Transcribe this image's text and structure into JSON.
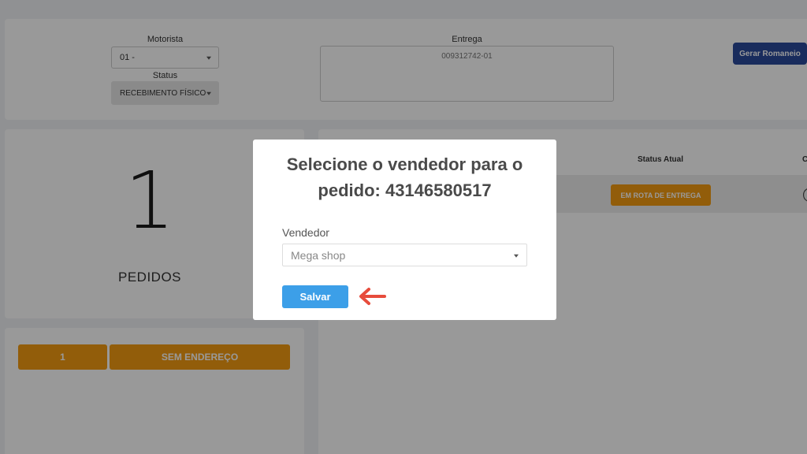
{
  "filters": {
    "motorista_label": "Motorista",
    "motorista_value": "01 -",
    "status_label": "Status",
    "status_value": "RECEBIMENTO FÍSICO",
    "entrega_label": "Entrega",
    "entrega_value": "009312742-01",
    "gerar_button": "Gerar Romaneio"
  },
  "summary": {
    "count": "1",
    "label": "PEDIDOS"
  },
  "table": {
    "columns": [
      "Status Atual",
      "C"
    ],
    "rows": [
      {
        "status": "EM ROTA DE ENTREGA"
      }
    ]
  },
  "bottom": {
    "count_button": "1",
    "address_button": "SEM ENDEREÇO"
  },
  "modal": {
    "title_line1": "Selecione o vendedor para o",
    "title_line2": "pedido: 43146580517",
    "vendedor_label": "Vendedor",
    "vendedor_value": "Mega shop",
    "save_button": "Salvar"
  },
  "colors": {
    "primary_blue": "#3c9fe8",
    "dark_blue": "#2a4a9c",
    "orange": "#f39c12",
    "arrow_red": "#e74c3c"
  }
}
